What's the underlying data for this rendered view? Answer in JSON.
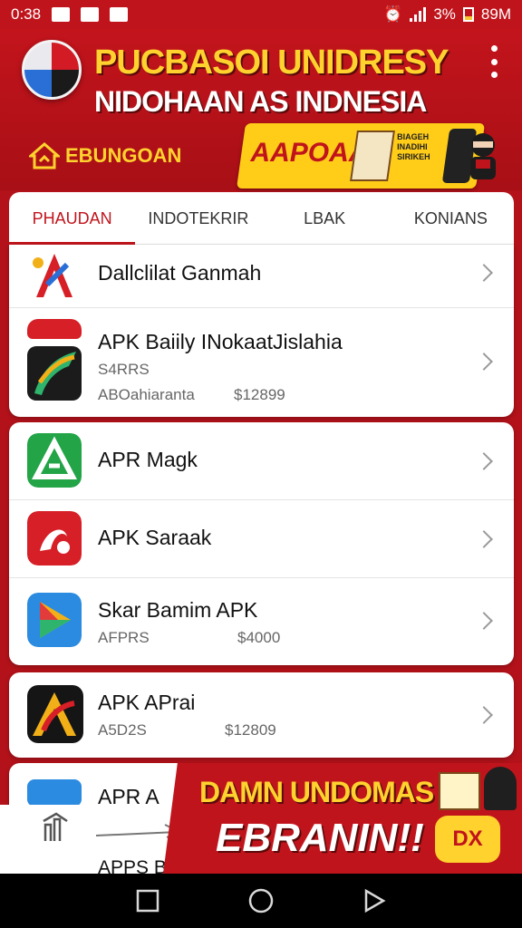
{
  "status_bar": {
    "time": "0:38",
    "battery_text": "3%",
    "extra_text": "89M"
  },
  "header": {
    "title_line1": "PUCBASOI UNIDRESY",
    "title_line2": "NIDOHAAN AS INDNESIA",
    "brand_label": "EBUNGOAN",
    "banner_text": "AAPOAA",
    "banner_tag": "BIAGEH INADIHI SIRIKEH"
  },
  "tabs": [
    {
      "label": "PHAUDAN",
      "active": true
    },
    {
      "label": "INDOTEKRIR",
      "active": false
    },
    {
      "label": "LBAK",
      "active": false
    },
    {
      "label": "KONIANS",
      "active": false
    }
  ],
  "cards": [
    {
      "rows": [
        {
          "name": "Dallclilat Ganmah",
          "sub": "",
          "price": ""
        },
        {
          "name": "APK Baiily INokaatJislahia",
          "sub": "S4RRS",
          "sub2": "ABOahiaranta",
          "price": "$12899"
        }
      ]
    },
    {
      "rows": [
        {
          "name": "APR Magk",
          "sub": "",
          "price": ""
        },
        {
          "name": "APK Saraak",
          "sub": "",
          "price": ""
        },
        {
          "name": "Skar Bamim APK",
          "sub": "AFPRS",
          "price": "$4000"
        }
      ]
    },
    {
      "rows": [
        {
          "name": "APK APrai",
          "sub": "A5D2S",
          "price": "$12809"
        }
      ]
    }
  ],
  "partial_rows": {
    "row1_name": "APR A",
    "row2_name": "APPS Bam"
  },
  "promo": {
    "line1": "DAMN UNDOMAS",
    "line2": "EBRANIN!!",
    "badge": "DX"
  },
  "colors": {
    "brand_red": "#c0141c",
    "accent_yellow": "#ffd22e",
    "text_dark": "#111111",
    "text_muted": "#666666"
  }
}
